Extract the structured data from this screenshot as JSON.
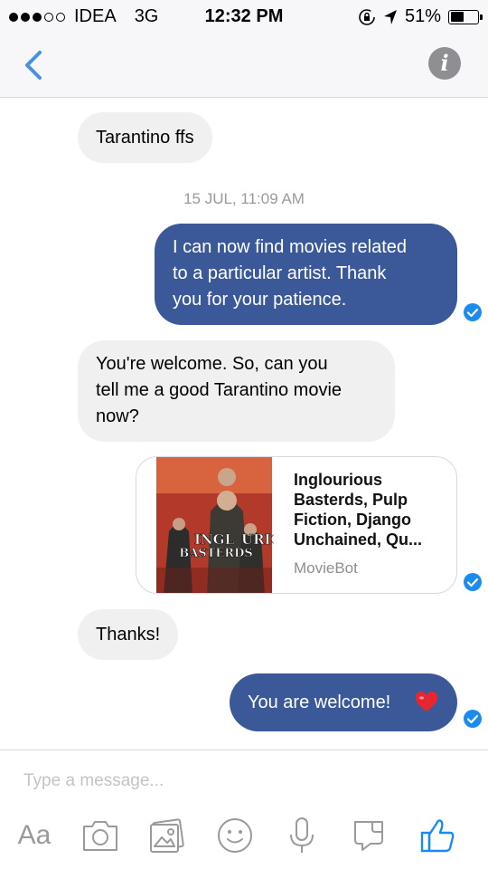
{
  "status_bar": {
    "carrier": "IDEA",
    "network": "3G",
    "time": "12:32 PM",
    "battery": "51%",
    "battery_level": 0.51
  },
  "nav": {
    "back_icon": "chevron-left-icon",
    "info_icon": "info-icon",
    "info_glyph": "i"
  },
  "messages": [
    {
      "direction": "incoming",
      "text": "Tarantino ffs"
    },
    {
      "direction": "timestamp",
      "text": "15 JUL, 11:09 AM"
    },
    {
      "direction": "outgoing",
      "lines": [
        "I can now find movies related",
        "to a particular artist. Thank",
        "you for your patience."
      ]
    },
    {
      "direction": "incoming",
      "lines": [
        "You're welcome. So, can you",
        "tell me a good Tarantino movie",
        "now?"
      ]
    },
    {
      "direction": "card",
      "poster_text": [
        "INGL",
        "URIOUS",
        "BASTERDS"
      ],
      "title_lines": [
        "Inglourious",
        "Basterds, Pulp",
        "Fiction, Django",
        "Unchained, Qu..."
      ],
      "source": "MovieBot"
    },
    {
      "direction": "incoming",
      "text": "Thanks!"
    },
    {
      "direction": "outgoing",
      "text": "You are welcome!",
      "emoji": "heart-icon"
    }
  ],
  "composer": {
    "placeholder": "Type a message...",
    "tools": [
      "Aa",
      "camera-icon",
      "gallery-icon",
      "emoji-icon",
      "microphone-icon",
      "sticker-icon",
      "like-icon"
    ]
  },
  "colors": {
    "outgoing_bubble": "#3b5998",
    "incoming_bubble": "#f1f0f0",
    "accent": "#1a8cf0",
    "ios_blue": "#4a90e2"
  }
}
